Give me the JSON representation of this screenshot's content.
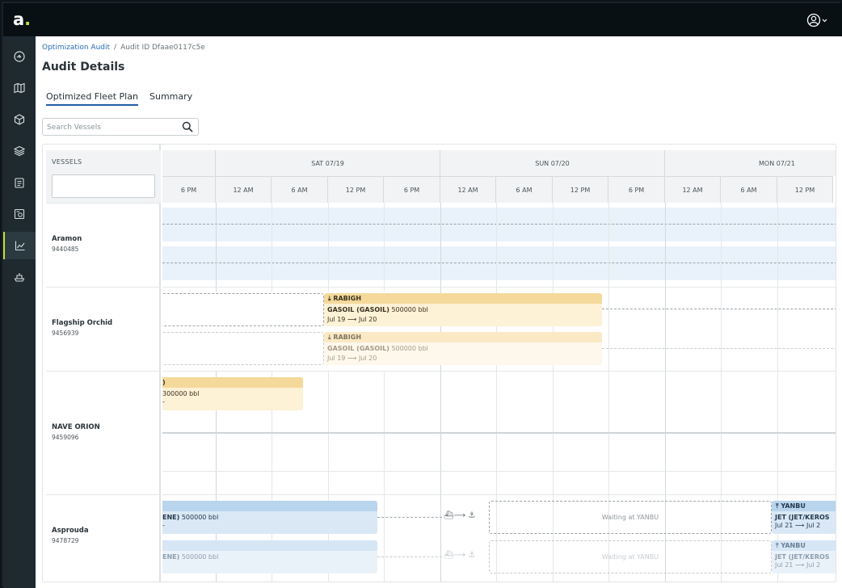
{
  "app": {
    "logo_text": "a",
    "logo_dot": ".",
    "accent": "#c6df3a"
  },
  "sidebar": {
    "items": [
      {
        "icon": "dashboard-icon"
      },
      {
        "icon": "map-icon"
      },
      {
        "icon": "cube-icon"
      },
      {
        "icon": "layers-icon"
      },
      {
        "icon": "clipboard-icon"
      },
      {
        "icon": "report-icon"
      },
      {
        "icon": "chart-icon",
        "active": true
      },
      {
        "icon": "ship-icon"
      }
    ]
  },
  "breadcrumb": {
    "parent": "Optimization Audit",
    "separator": "/",
    "current": "Audit ID Dfaae0117c5e"
  },
  "page_title": "Audit Details",
  "tabs": [
    {
      "label": "Optimized Fleet Plan",
      "active": true
    },
    {
      "label": "Summary",
      "active": false
    }
  ],
  "search": {
    "placeholder": "Search Vessels"
  },
  "timeline": {
    "vessels_header": "VESSELS",
    "days": [
      "SAT 07/19",
      "SUN 07/20",
      "MON 07/21"
    ],
    "hours": [
      "6 PM",
      "12 AM",
      "6 AM",
      "12 PM",
      "6 PM",
      "12 AM",
      "6 AM",
      "12 PM",
      "6 PM",
      "12 AM",
      "6 AM",
      "12 PM"
    ]
  },
  "vessels": [
    {
      "name": "Aramon",
      "id": "9440485"
    },
    {
      "name": "Flagship Orchid",
      "id": "9456939"
    },
    {
      "name": "NAVE ORION",
      "id": "9459096"
    },
    {
      "name": "Asprouda",
      "id": "9478729"
    }
  ],
  "events": {
    "orchid_main": {
      "port": "RABIGH",
      "cargo": "GASOIL (GASOIL)",
      "qty": "500000 bbl",
      "from": "Jul 19",
      "arrow": "⟶",
      "to": "Jul 20"
    },
    "orchid_ghost": {
      "port": "RABIGH",
      "cargo": "GASOIL (GASOIL)",
      "qty": "500000 bbl",
      "from": "Jul 19",
      "arrow": "⟶",
      "to": "Jul 20"
    },
    "orion_main": {
      "port": ")",
      "qty": "300000 bbl",
      "dates": "-"
    },
    "asprouda_main": {
      "cargo": "ENE)",
      "qty": "500000 bbl",
      "dates": "-"
    },
    "asprouda_ghost": {
      "cargo": "ENE)",
      "qty": "500000 bbl"
    },
    "asprouda_wait": {
      "label": "Waiting at YANBU"
    },
    "asprouda_wait_ghost": {
      "label": "Waiting at YANBU"
    },
    "asprouda_next": {
      "port": "YANBU",
      "cargo": "JET (JET/KEROS",
      "from": "Jul 21",
      "arrow": "⟶",
      "to": "Jul 2"
    },
    "asprouda_next_ghost": {
      "port": "YANBU",
      "cargo": "JET (JET/KEROS",
      "from": "Jul 21",
      "arrow": "⟶",
      "to": "Jul 2"
    }
  }
}
